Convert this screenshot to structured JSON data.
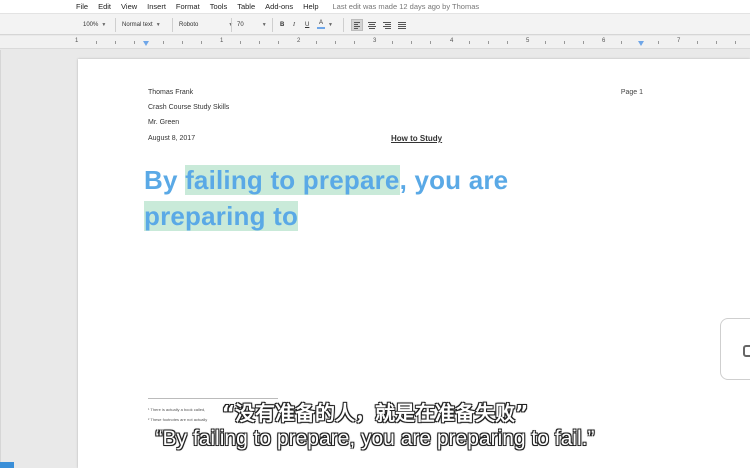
{
  "menu": [
    "File",
    "Edit",
    "View",
    "Insert",
    "Format",
    "Tools",
    "Table",
    "Add-ons",
    "Help"
  ],
  "last_edit": "Last edit was made 12 days ago by Thomas",
  "toolbar": {
    "zoom": "100%",
    "style": "Normal text",
    "font": "Roboto",
    "size": "70",
    "bold": "B",
    "italic": "I",
    "underline": "U",
    "text_color": "A"
  },
  "ruler": [
    "1",
    "1",
    "2",
    "3",
    "4",
    "5",
    "6",
    "7"
  ],
  "doc": {
    "meta": [
      "Thomas Frank",
      "Crash Course Study Skills",
      "Mr. Green",
      "August 8, 2017"
    ],
    "title": "How to Study",
    "page_label": "Page 1",
    "heading": {
      "part1": "By ",
      "hl1": "failing to prepare",
      "part2": ", you are",
      "hl2": "preparing to"
    },
    "footnotes": [
      "¹ There is actually a book called,",
      "² These footnotes are not actually"
    ]
  },
  "subtitles": {
    "cn": "“没有准备的人，就是在准备失败”",
    "en": "“By failing to prepare, you are preparing to fail.”"
  },
  "colors": {
    "heading": "#5aa9e6",
    "highlight": "#c9ead9",
    "accent": "#6fa6e8"
  }
}
